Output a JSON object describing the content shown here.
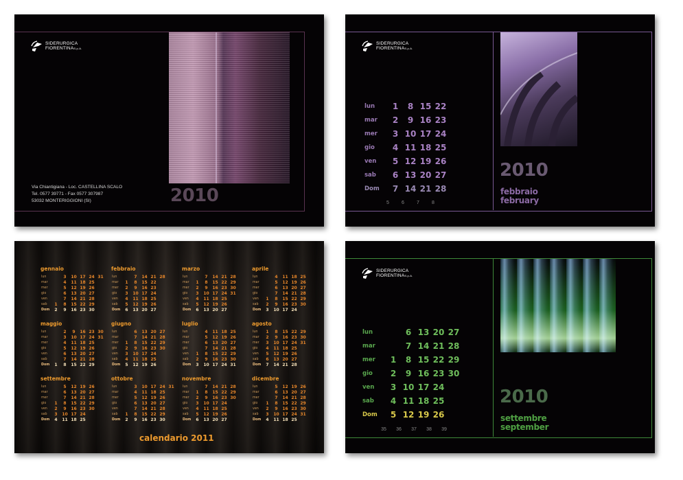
{
  "logo": {
    "line1": "SIDERURGICA",
    "line2": "FIORENTINA",
    "suffix": "S.p.A."
  },
  "card1": {
    "year": "2010",
    "address": [
      "Via Chiantigiana - Loc. CASTELLINA SCALO",
      "Tel. 0577 39771 - Fax 0577 307987",
      "53032 MONTERIGGIONI (SI)"
    ],
    "accent": "#6e3a5c"
  },
  "card2": {
    "year": "2010",
    "month_it": "febbraio",
    "month_en": "february",
    "accent": "#8b6aa4",
    "days": [
      "lun",
      "mar",
      "mer",
      "gio",
      "ven",
      "sab",
      "Dom"
    ],
    "rows": [
      [
        "1",
        "8",
        "15",
        "22"
      ],
      [
        "2",
        "9",
        "16",
        "23"
      ],
      [
        "3",
        "10",
        "17",
        "24"
      ],
      [
        "4",
        "11",
        "18",
        "25"
      ],
      [
        "5",
        "12",
        "19",
        "26"
      ],
      [
        "6",
        "13",
        "20",
        "27"
      ],
      [
        "7",
        "14",
        "21",
        "28"
      ]
    ],
    "weeks": [
      "5",
      "6",
      "7",
      "8"
    ]
  },
  "card3": {
    "title": "calendario 2011",
    "days": [
      "lun",
      "mar",
      "mer",
      "gio",
      "ven",
      "sab",
      "Dom"
    ],
    "months": [
      {
        "name": "gennaio",
        "rows": [
          [
            "",
            "3",
            "10",
            "17",
            "24",
            "31"
          ],
          [
            "",
            "4",
            "11",
            "18",
            "25",
            ""
          ],
          [
            "",
            "5",
            "12",
            "19",
            "26",
            ""
          ],
          [
            "",
            "6",
            "13",
            "20",
            "27",
            ""
          ],
          [
            "",
            "7",
            "14",
            "21",
            "28",
            ""
          ],
          [
            "1",
            "8",
            "15",
            "22",
            "29",
            ""
          ],
          [
            "2",
            "9",
            "16",
            "23",
            "30",
            ""
          ]
        ]
      },
      {
        "name": "febbraio",
        "rows": [
          [
            "",
            "7",
            "14",
            "21",
            "28"
          ],
          [
            "1",
            "8",
            "15",
            "22",
            ""
          ],
          [
            "2",
            "9",
            "16",
            "23",
            ""
          ],
          [
            "3",
            "10",
            "17",
            "24",
            ""
          ],
          [
            "4",
            "11",
            "18",
            "25",
            ""
          ],
          [
            "5",
            "12",
            "19",
            "26",
            ""
          ],
          [
            "6",
            "13",
            "20",
            "27",
            ""
          ]
        ]
      },
      {
        "name": "marzo",
        "rows": [
          [
            "",
            "7",
            "14",
            "21",
            "28"
          ],
          [
            "1",
            "8",
            "15",
            "22",
            "29"
          ],
          [
            "2",
            "9",
            "16",
            "23",
            "30"
          ],
          [
            "3",
            "10",
            "17",
            "24",
            "31"
          ],
          [
            "4",
            "11",
            "18",
            "25",
            ""
          ],
          [
            "5",
            "12",
            "19",
            "26",
            ""
          ],
          [
            "6",
            "13",
            "20",
            "27",
            ""
          ]
        ]
      },
      {
        "name": "aprile",
        "rows": [
          [
            "",
            "4",
            "11",
            "18",
            "25"
          ],
          [
            "",
            "5",
            "12",
            "19",
            "26"
          ],
          [
            "",
            "6",
            "13",
            "20",
            "27"
          ],
          [
            "",
            "7",
            "14",
            "21",
            "28"
          ],
          [
            "1",
            "8",
            "15",
            "22",
            "29"
          ],
          [
            "2",
            "9",
            "16",
            "23",
            "30"
          ],
          [
            "3",
            "10",
            "17",
            "24",
            ""
          ]
        ]
      },
      {
        "name": "maggio",
        "rows": [
          [
            "",
            "2",
            "9",
            "16",
            "23",
            "30"
          ],
          [
            "",
            "3",
            "10",
            "17",
            "24",
            "31"
          ],
          [
            "",
            "4",
            "11",
            "18",
            "25",
            ""
          ],
          [
            "",
            "5",
            "12",
            "19",
            "26",
            ""
          ],
          [
            "",
            "6",
            "13",
            "20",
            "27",
            ""
          ],
          [
            "",
            "7",
            "14",
            "21",
            "28",
            ""
          ],
          [
            "1",
            "8",
            "15",
            "22",
            "29",
            ""
          ]
        ]
      },
      {
        "name": "giugno",
        "rows": [
          [
            "",
            "6",
            "13",
            "20",
            "27"
          ],
          [
            "",
            "7",
            "14",
            "21",
            "28"
          ],
          [
            "1",
            "8",
            "15",
            "22",
            "29"
          ],
          [
            "2",
            "9",
            "16",
            "23",
            "30"
          ],
          [
            "3",
            "10",
            "17",
            "24",
            ""
          ],
          [
            "4",
            "11",
            "18",
            "25",
            ""
          ],
          [
            "5",
            "12",
            "19",
            "26",
            ""
          ]
        ]
      },
      {
        "name": "luglio",
        "rows": [
          [
            "",
            "4",
            "11",
            "18",
            "25"
          ],
          [
            "",
            "5",
            "12",
            "19",
            "26"
          ],
          [
            "",
            "6",
            "13",
            "20",
            "27"
          ],
          [
            "",
            "7",
            "14",
            "21",
            "28"
          ],
          [
            "1",
            "8",
            "15",
            "22",
            "29"
          ],
          [
            "2",
            "9",
            "16",
            "23",
            "30"
          ],
          [
            "3",
            "10",
            "17",
            "24",
            "31"
          ]
        ]
      },
      {
        "name": "agosto",
        "rows": [
          [
            "1",
            "8",
            "15",
            "22",
            "29"
          ],
          [
            "2",
            "9",
            "16",
            "23",
            "30"
          ],
          [
            "3",
            "10",
            "17",
            "24",
            "31"
          ],
          [
            "4",
            "11",
            "18",
            "25",
            ""
          ],
          [
            "5",
            "12",
            "19",
            "26",
            ""
          ],
          [
            "6",
            "13",
            "20",
            "27",
            ""
          ],
          [
            "7",
            "14",
            "21",
            "28",
            ""
          ]
        ]
      },
      {
        "name": "settembre",
        "rows": [
          [
            "",
            "5",
            "12",
            "19",
            "26"
          ],
          [
            "",
            "6",
            "13",
            "20",
            "27"
          ],
          [
            "",
            "7",
            "14",
            "21",
            "28"
          ],
          [
            "1",
            "8",
            "15",
            "22",
            "29"
          ],
          [
            "2",
            "9",
            "16",
            "23",
            "30"
          ],
          [
            "3",
            "10",
            "17",
            "24",
            ""
          ],
          [
            "4",
            "11",
            "18",
            "25",
            ""
          ]
        ]
      },
      {
        "name": "ottobre",
        "rows": [
          [
            "",
            "3",
            "10",
            "17",
            "24",
            "31"
          ],
          [
            "",
            "4",
            "11",
            "18",
            "25",
            ""
          ],
          [
            "",
            "5",
            "12",
            "19",
            "26",
            ""
          ],
          [
            "",
            "6",
            "13",
            "20",
            "27",
            ""
          ],
          [
            "",
            "7",
            "14",
            "21",
            "28",
            ""
          ],
          [
            "1",
            "8",
            "15",
            "22",
            "29",
            ""
          ],
          [
            "2",
            "9",
            "16",
            "23",
            "30",
            ""
          ]
        ]
      },
      {
        "name": "novembre",
        "rows": [
          [
            "",
            "7",
            "14",
            "21",
            "28"
          ],
          [
            "1",
            "8",
            "15",
            "22",
            "29"
          ],
          [
            "2",
            "9",
            "16",
            "23",
            "30"
          ],
          [
            "3",
            "10",
            "17",
            "24",
            ""
          ],
          [
            "4",
            "11",
            "18",
            "25",
            ""
          ],
          [
            "5",
            "12",
            "19",
            "26",
            ""
          ],
          [
            "6",
            "13",
            "20",
            "27",
            ""
          ]
        ]
      },
      {
        "name": "dicembre",
        "rows": [
          [
            "",
            "5",
            "12",
            "19",
            "26"
          ],
          [
            "",
            "6",
            "13",
            "20",
            "27"
          ],
          [
            "",
            "7",
            "14",
            "21",
            "28"
          ],
          [
            "1",
            "8",
            "15",
            "22",
            "29"
          ],
          [
            "2",
            "9",
            "16",
            "23",
            "30"
          ],
          [
            "3",
            "10",
            "17",
            "24",
            "31"
          ],
          [
            "4",
            "11",
            "18",
            "25",
            ""
          ]
        ]
      }
    ]
  },
  "card4": {
    "year": "2010",
    "month_it": "settembre",
    "month_en": "september",
    "accent": "#4fa043",
    "days": [
      "lun",
      "mar",
      "mer",
      "gio",
      "ven",
      "sab",
      "Dom"
    ],
    "rows": [
      [
        "",
        "6",
        "13",
        "20",
        "27"
      ],
      [
        "",
        "7",
        "14",
        "21",
        "28"
      ],
      [
        "1",
        "8",
        "15",
        "22",
        "29"
      ],
      [
        "2",
        "9",
        "16",
        "23",
        "30"
      ],
      [
        "3",
        "10",
        "17",
        "24",
        ""
      ],
      [
        "4",
        "11",
        "18",
        "25",
        ""
      ],
      [
        "5",
        "12",
        "19",
        "26",
        ""
      ]
    ],
    "weeks": [
      "35",
      "36",
      "37",
      "38",
      "39"
    ]
  }
}
